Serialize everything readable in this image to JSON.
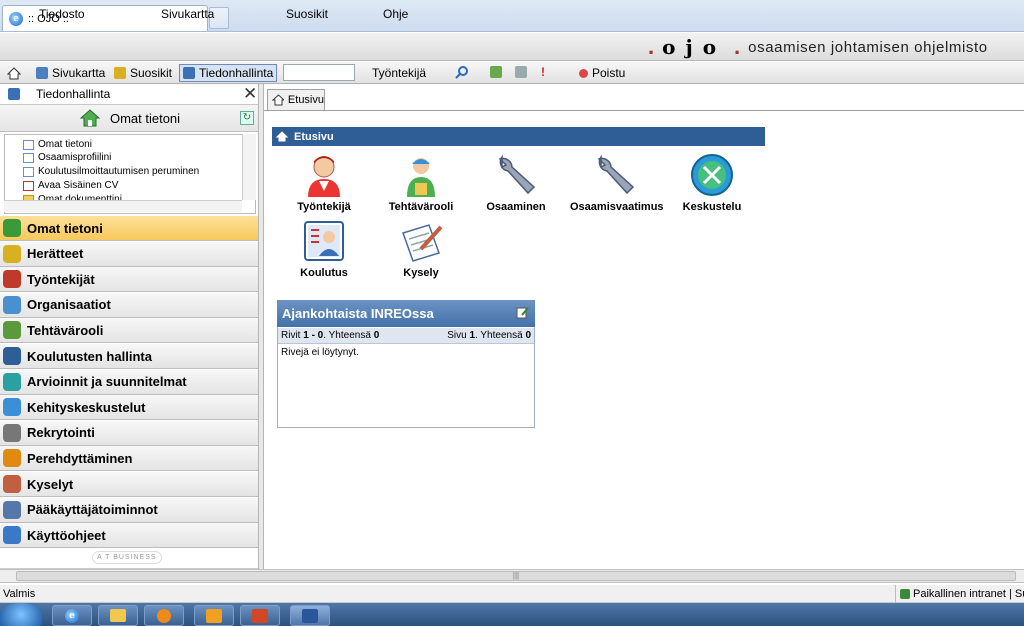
{
  "browser": {
    "tab_title": ":: OJO ::",
    "icon": "ie-icon"
  },
  "menubar": {
    "items": [
      "Tiedosto",
      "Sivukartta",
      "Suosikit",
      "Ohje"
    ],
    "logo_text": "ojo",
    "tagline": "osaamisen johtamisen ohjelmisto"
  },
  "toolbar": {
    "sivukartta": "Sivukartta",
    "suosikit": "Suosikit",
    "tiedonhallinta": "Tiedonhallinta",
    "search_value": "",
    "search_scope": "Työntekijä",
    "logout": "Poistu"
  },
  "left_panel": {
    "title": "Tiedonhallinta",
    "subtitle": "Omat tietoni",
    "tree": [
      "Omat tietoni",
      "Osaamisprofiilini",
      "Koulutusilmoittautumisen peruminen",
      "Avaa Sisäinen CV",
      "Omat dokumenttini"
    ],
    "accordion": [
      {
        "label": "Omat tietoni",
        "active": true,
        "color": "#3a9a3a"
      },
      {
        "label": "Herätteet",
        "color": "#d9b020"
      },
      {
        "label": "Työntekijät",
        "color": "#c0392b"
      },
      {
        "label": "Organisaatiot",
        "color": "#4a8fd0"
      },
      {
        "label": "Tehtävärooli",
        "color": "#5a9a3a"
      },
      {
        "label": "Koulutusten hallinta",
        "color": "#2f5d95"
      },
      {
        "label": "Arvioinnit ja suunnitelmat",
        "color": "#2aa0a0"
      },
      {
        "label": "Kehityskeskustelut",
        "color": "#3b8ed8"
      },
      {
        "label": "Rekrytointi",
        "color": "#777777"
      },
      {
        "label": "Perehdyttäminen",
        "color": "#e08a10"
      },
      {
        "label": "Kyselyt",
        "color": "#c06040"
      },
      {
        "label": "Pääkäyttäjätoiminnot",
        "color": "#5577aa"
      },
      {
        "label": "Käyttöohjeet",
        "color": "#3a78c8"
      }
    ],
    "brand": "A T BUSINESS"
  },
  "content": {
    "tab": "Etusivu",
    "section_title": "Etusivu",
    "apps": [
      {
        "label": "Työntekijä",
        "icon": "worker-icon"
      },
      {
        "label": "Tehtävärooli",
        "icon": "role-icon"
      },
      {
        "label": "Osaaminen",
        "icon": "wrench-icon"
      },
      {
        "label": "Osaamisvaatimus",
        "icon": "wrench-icon"
      },
      {
        "label": "Keskustelu",
        "icon": "discussion-icon"
      },
      {
        "label": "Koulutus",
        "icon": "training-icon"
      },
      {
        "label": "Kysely",
        "icon": "survey-icon"
      }
    ],
    "news": {
      "title": "Ajankohtaista INREOssa",
      "rows_label": "Rivit",
      "rows_range": "1 - 0",
      "total_label": "Yhteensä",
      "total": "0",
      "page_label": "Sivu",
      "page": "1",
      "page_total": "0",
      "empty": "Rivejä ei löytynyt."
    }
  },
  "status": {
    "left": "Valmis",
    "zone": "Paikallinen intranet | Suoj"
  }
}
